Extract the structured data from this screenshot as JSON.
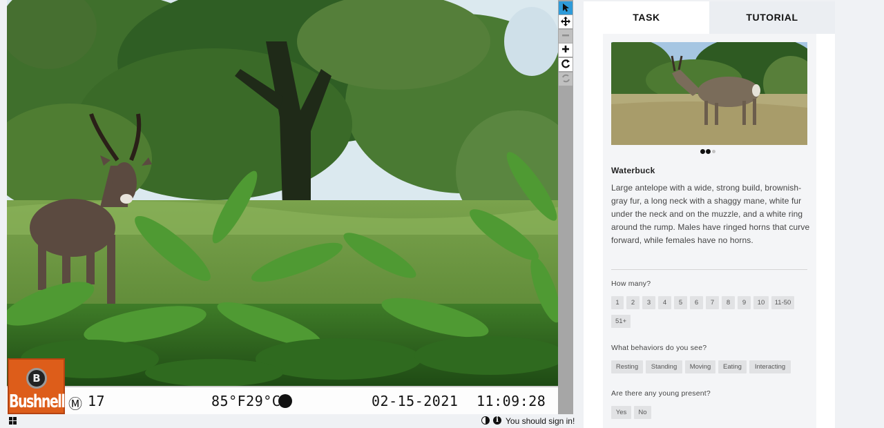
{
  "camera": {
    "brand": "Bushnell",
    "emblem": "B",
    "moon_phase": "Ⓜ",
    "camera_number": "17",
    "temperature": "85°F29°C",
    "date": "02-15-2021",
    "time": "11:09:28"
  },
  "toolbar": {
    "tools": [
      "pointer-tool",
      "move-tool",
      "zoom-out-tool",
      "zoom-in-tool",
      "rotate-tool",
      "reset-tool"
    ]
  },
  "footer": {
    "signin_text": "You should sign in!",
    "info_glyph": "i"
  },
  "tabs": {
    "task": "TASK",
    "tutorial": "TUTORIAL"
  },
  "species": {
    "name": "Waterbuck",
    "description": "Large antelope with a wide, strong build, brownish-gray fur, a long neck with a shaggy mane, white fur under the neck and on the muzzle, and a white ring around the rump. Males have ringed horns that curve forward, while females have no horns.",
    "image_count": 3,
    "active_image": 1
  },
  "questions": {
    "how_many": {
      "label": "How many?",
      "options": [
        "1",
        "2",
        "3",
        "4",
        "5",
        "6",
        "7",
        "8",
        "9",
        "10",
        "11-50",
        "51+"
      ]
    },
    "behaviors": {
      "label": "What behaviors do you see?",
      "options": [
        "Resting",
        "Standing",
        "Moving",
        "Eating",
        "Interacting"
      ]
    },
    "young": {
      "label": "Are there any young present?",
      "options": [
        "Yes",
        "No"
      ]
    }
  },
  "colors": {
    "active_tool": "#2e9bd9",
    "bushnell_orange": "#dd5d1a",
    "chip_bg": "#e1e2e4"
  }
}
